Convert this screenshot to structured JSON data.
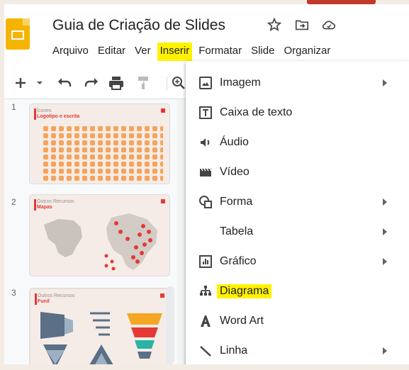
{
  "header": {
    "title": "Guia de Criação de Slides",
    "menus": [
      {
        "label": "Arquivo",
        "active": false
      },
      {
        "label": "Editar",
        "active": false
      },
      {
        "label": "Ver",
        "active": false
      },
      {
        "label": "Inserir",
        "active": true
      },
      {
        "label": "Formatar",
        "active": false
      },
      {
        "label": "Slide",
        "active": false
      },
      {
        "label": "Organizar",
        "active": false
      }
    ],
    "icons": [
      "star-icon",
      "move-to-folder-icon",
      "cloud-status-icon"
    ]
  },
  "toolbar": {
    "icons": [
      "add-icon",
      "dropdown-arrow-icon",
      "undo-icon",
      "redo-icon",
      "print-icon",
      "paint-format-icon",
      "zoom-icon"
    ]
  },
  "filmstrip": {
    "slides": [
      {
        "number": "1",
        "label": "Ícones",
        "sub": "Logotipo e escrita"
      },
      {
        "number": "2",
        "label": "Outros Recursos",
        "sub": "Mapas"
      },
      {
        "number": "3",
        "label": "Outros Recursos",
        "sub": "Funil"
      }
    ]
  },
  "insert_menu": {
    "items": [
      {
        "label": "Imagem",
        "icon": "image-icon",
        "submenu": true,
        "highlighted": false
      },
      {
        "label": "Caixa de texto",
        "icon": "text-box-icon",
        "submenu": false,
        "highlighted": false
      },
      {
        "label": "Áudio",
        "icon": "audio-icon",
        "submenu": false,
        "highlighted": false
      },
      {
        "label": "Vídeo",
        "icon": "video-icon",
        "submenu": false,
        "highlighted": false
      },
      {
        "label": "Forma",
        "icon": "shape-icon",
        "submenu": true,
        "highlighted": false
      },
      {
        "label": "Tabela",
        "icon": "",
        "submenu": true,
        "highlighted": false
      },
      {
        "label": "Gráfico",
        "icon": "chart-icon",
        "submenu": true,
        "highlighted": false
      },
      {
        "label": "Diagrama",
        "icon": "diagram-icon",
        "submenu": false,
        "highlighted": true
      },
      {
        "label": "Word Art",
        "icon": "word-art-icon",
        "submenu": false,
        "highlighted": false
      },
      {
        "label": "Linha",
        "icon": "line-icon",
        "submenu": true,
        "highlighted": false
      }
    ]
  },
  "colors": {
    "highlight": "#fff200",
    "logo": "#f4b400",
    "accent_red": "#e53935",
    "thumb_orange": "#f6a35b"
  }
}
